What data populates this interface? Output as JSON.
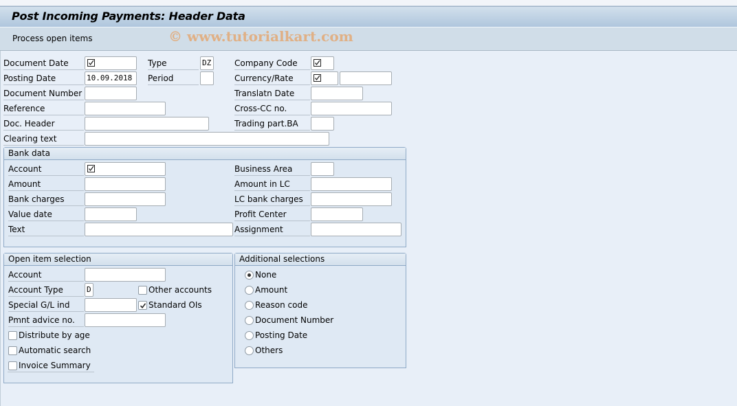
{
  "window": {
    "title": "Post Incoming Payments: Header Data"
  },
  "toolbar": {
    "process_open_items_label": "Process open items"
  },
  "watermark": "© www.tutorialkart.com",
  "header_fields": {
    "document_date": {
      "label": "Document Date",
      "value": "",
      "required": true
    },
    "type": {
      "label": "Type",
      "value": "DZ"
    },
    "company_code": {
      "label": "Company Code",
      "value": "",
      "required": true
    },
    "posting_date": {
      "label": "Posting Date",
      "value": "10.09.2018"
    },
    "period": {
      "label": "Period",
      "value": ""
    },
    "currency_rate": {
      "label": "Currency/Rate",
      "value": "",
      "required": true,
      "rate_value": ""
    },
    "document_number": {
      "label": "Document Number",
      "value": ""
    },
    "translatn_date": {
      "label": "Translatn Date",
      "value": ""
    },
    "reference": {
      "label": "Reference",
      "value": ""
    },
    "cross_cc_no": {
      "label": "Cross-CC no.",
      "value": ""
    },
    "doc_header": {
      "label": "Doc. Header",
      "value": ""
    },
    "trading_part_ba": {
      "label": "Trading part.BA",
      "value": ""
    },
    "clearing_text": {
      "label": "Clearing text",
      "value": ""
    }
  },
  "bank_data": {
    "title": "Bank data",
    "account": {
      "label": "Account",
      "value": "",
      "required": true
    },
    "business_area": {
      "label": "Business Area",
      "value": ""
    },
    "amount": {
      "label": "Amount",
      "value": ""
    },
    "amount_in_lc": {
      "label": "Amount in LC",
      "value": ""
    },
    "bank_charges": {
      "label": "Bank charges",
      "value": ""
    },
    "lc_bank_charges": {
      "label": "LC bank charges",
      "value": ""
    },
    "value_date": {
      "label": "Value date",
      "value": ""
    },
    "profit_center": {
      "label": "Profit Center",
      "value": ""
    },
    "text": {
      "label": "Text",
      "value": ""
    },
    "assignment": {
      "label": "Assignment",
      "value": ""
    }
  },
  "open_item_selection": {
    "title": "Open item selection",
    "account": {
      "label": "Account",
      "value": ""
    },
    "account_type": {
      "label": "Account Type",
      "value": "D"
    },
    "special_gl_ind": {
      "label": "Special G/L ind",
      "value": ""
    },
    "pmnt_advice_no": {
      "label": "Pmnt advice no.",
      "value": ""
    },
    "other_accounts": {
      "label": "Other accounts",
      "checked": false
    },
    "standard_ois": {
      "label": "Standard OIs",
      "checked": true
    },
    "distribute_by_age": {
      "label": "Distribute by age",
      "checked": false
    },
    "automatic_search": {
      "label": "Automatic search",
      "checked": false
    },
    "invoice_summary": {
      "label": "Invoice Summary",
      "checked": false
    }
  },
  "additional_selections": {
    "title": "Additional selections",
    "options": [
      {
        "label": "None",
        "selected": true
      },
      {
        "label": "Amount",
        "selected": false
      },
      {
        "label": "Reason code",
        "selected": false
      },
      {
        "label": "Document Number",
        "selected": false
      },
      {
        "label": "Posting Date",
        "selected": false
      },
      {
        "label": "Others",
        "selected": false
      }
    ]
  }
}
